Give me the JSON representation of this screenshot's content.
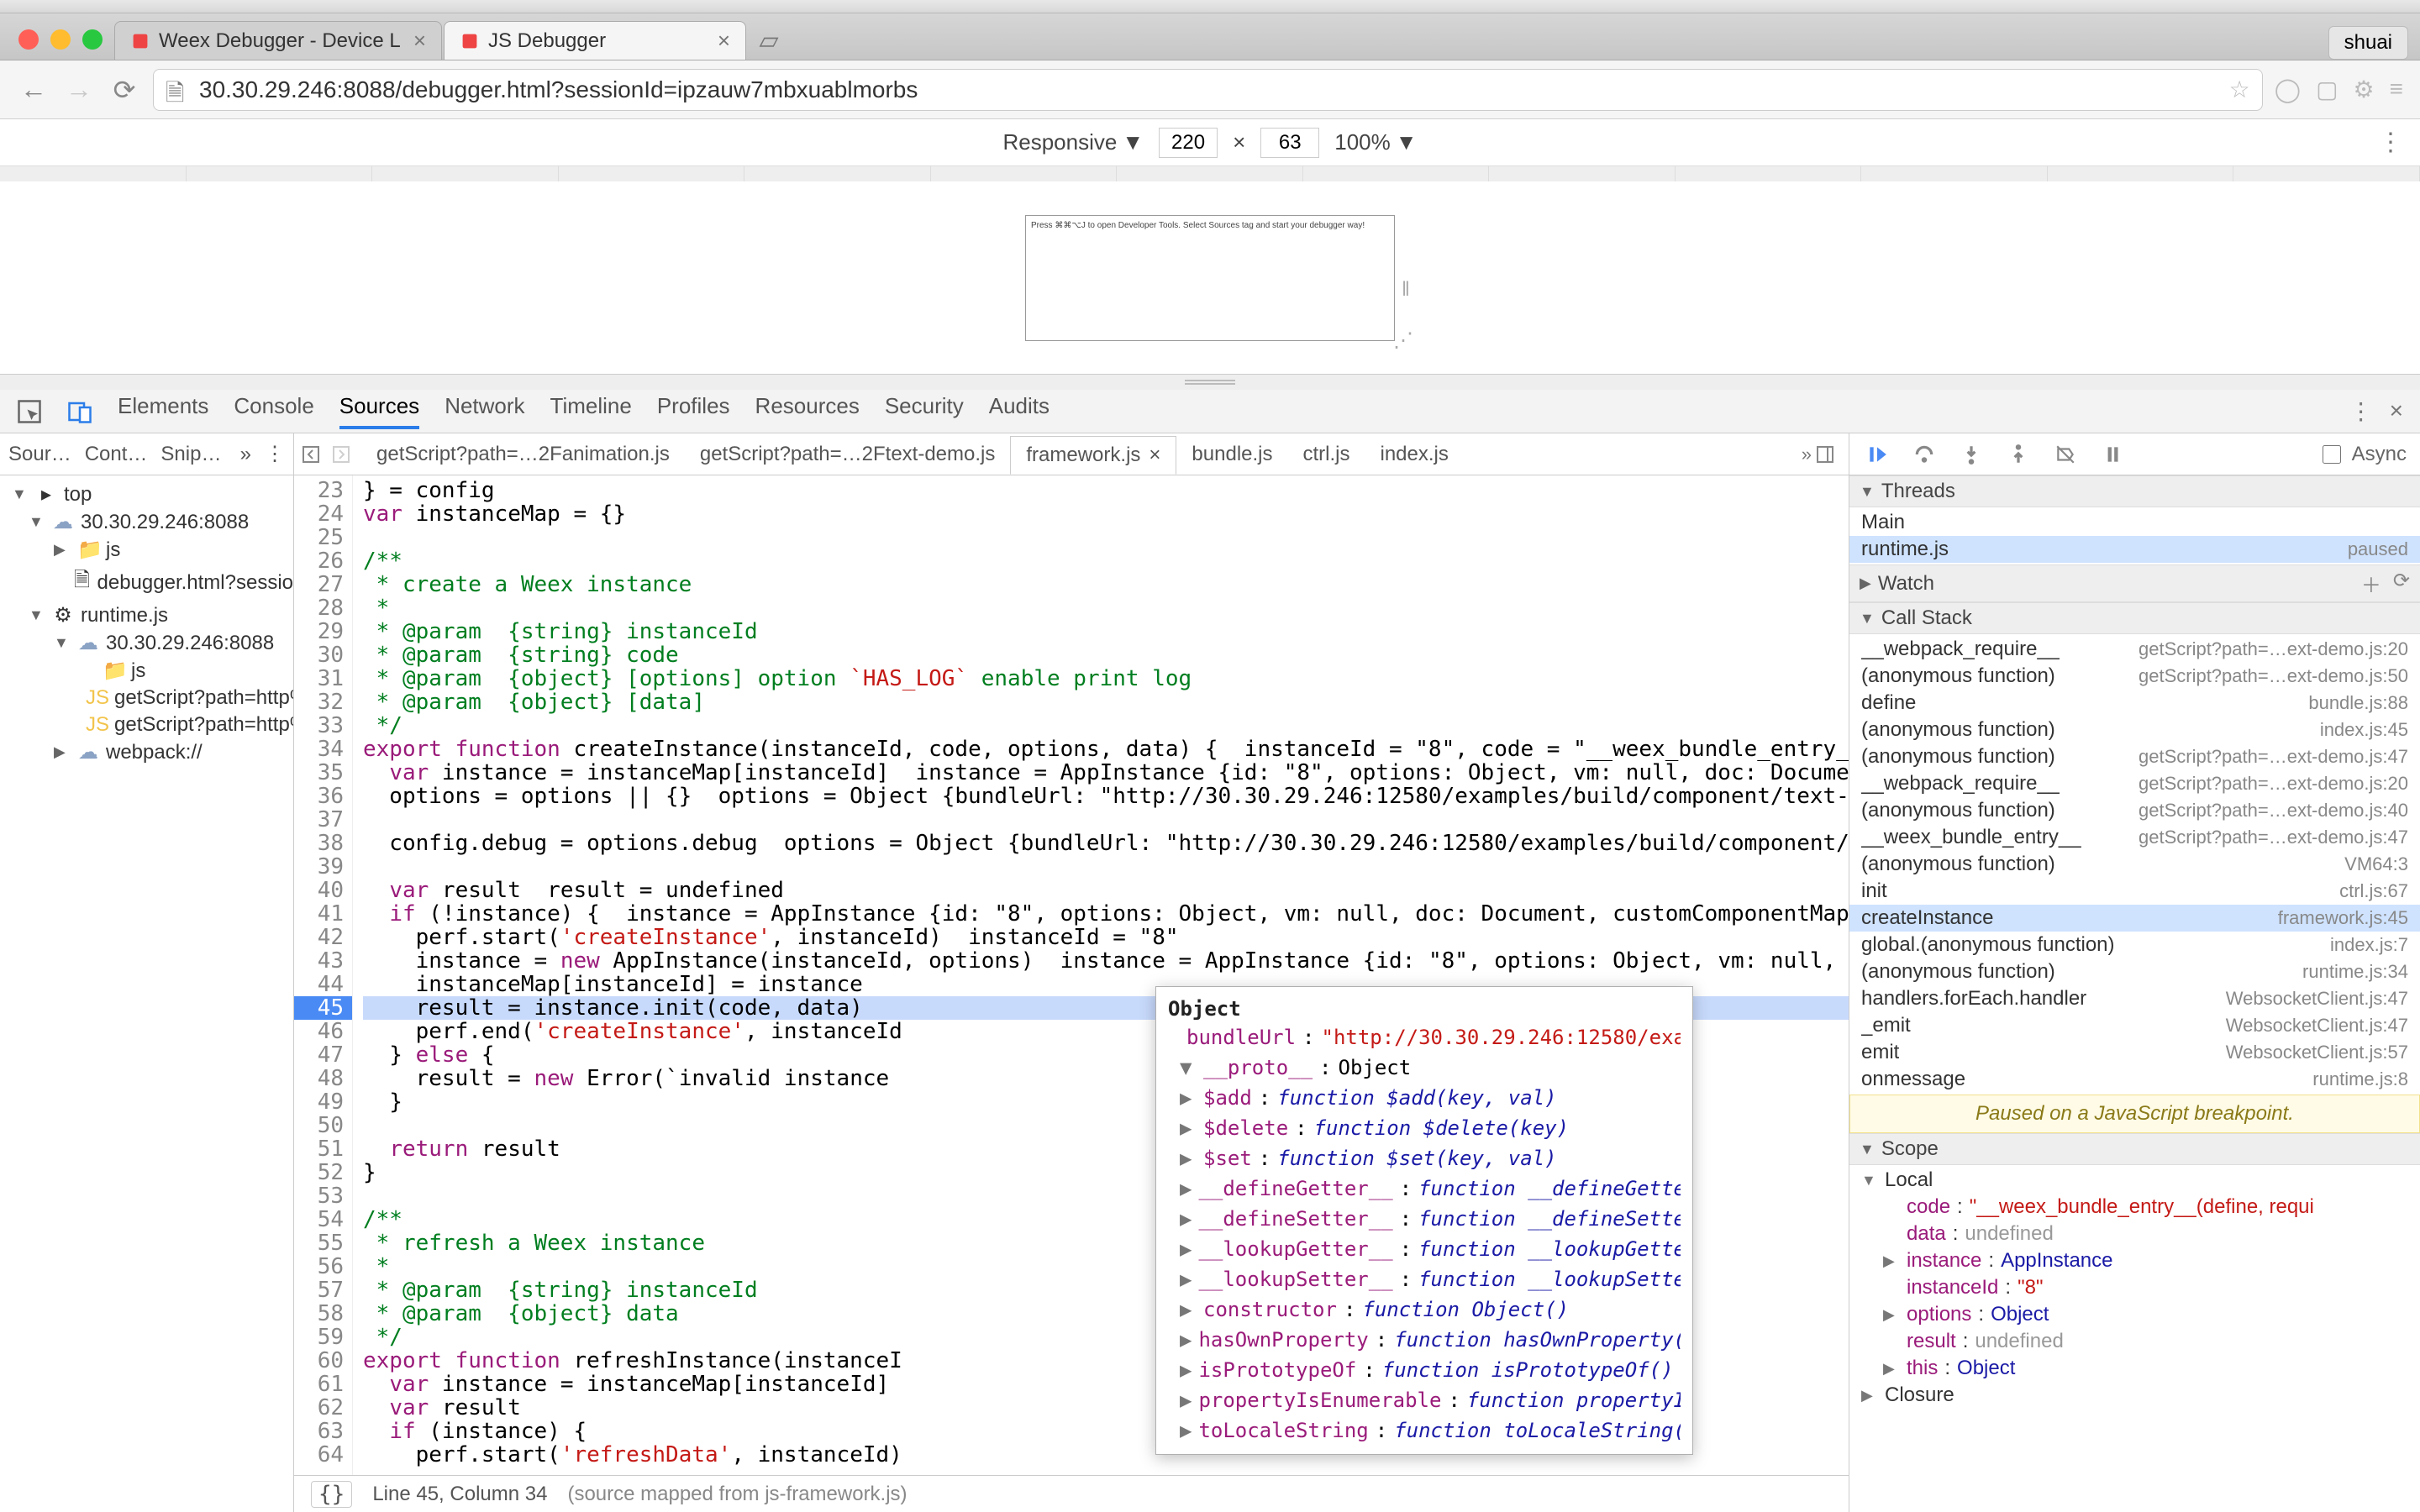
{
  "browser": {
    "tabs": [
      {
        "title": "Weex Debugger - Device L"
      },
      {
        "title": "JS Debugger"
      }
    ],
    "user": "shuai",
    "url": "30.30.29.246:8088/debugger.html?sessionId=ipzauw7mbxuablmorbs"
  },
  "device_toolbar": {
    "mode": "Responsive",
    "width": "220",
    "height": "63",
    "zoom": "100%"
  },
  "device_page_hint": "Press ⌘⌘⌥J to open Developer Tools. Select Sources tag and start your debugger way!",
  "panels": [
    "Elements",
    "Console",
    "Sources",
    "Network",
    "Timeline",
    "Profiles",
    "Resources",
    "Security",
    "Audits"
  ],
  "active_panel": "Sources",
  "file_tabs": {
    "items": [
      "Sour…",
      "Cont…",
      "Snip…"
    ]
  },
  "file_tree": [
    {
      "d": 0,
      "arr": "▼",
      "icon": "top",
      "label": "top"
    },
    {
      "d": 1,
      "arr": "▼",
      "icon": "cloud",
      "label": "30.30.29.246:8088"
    },
    {
      "d": 2,
      "arr": "▶",
      "icon": "folder",
      "label": "js"
    },
    {
      "d": 2,
      "arr": "",
      "icon": "file",
      "label": "debugger.html?sessio"
    },
    {
      "d": 1,
      "arr": "▼",
      "icon": "ext",
      "label": "runtime.js"
    },
    {
      "d": 2,
      "arr": "▼",
      "icon": "cloud",
      "label": "30.30.29.246:8088"
    },
    {
      "d": 3,
      "arr": "",
      "icon": "folder",
      "label": "js"
    },
    {
      "d": 3,
      "arr": "",
      "icon": "js",
      "label": "getScript?path=http%"
    },
    {
      "d": 3,
      "arr": "",
      "icon": "js",
      "label": "getScript?path=http%"
    },
    {
      "d": 2,
      "arr": "▶",
      "icon": "cloud",
      "label": "webpack://"
    }
  ],
  "editor_tabs": [
    {
      "label": "getScript?path=…2Fanimation.js",
      "active": false,
      "close": false
    },
    {
      "label": "getScript?path=…2Ftext-demo.js",
      "active": false,
      "close": false
    },
    {
      "label": "framework.js",
      "active": true,
      "close": true
    },
    {
      "label": "bundle.js",
      "active": false,
      "close": false
    },
    {
      "label": "ctrl.js",
      "active": false,
      "close": false
    },
    {
      "label": "index.js",
      "active": false,
      "close": false
    }
  ],
  "code": {
    "first_line": 23,
    "highlight_line": 45,
    "lines": [
      "} = config",
      "var instanceMap = {}",
      "",
      "/**",
      " * create a Weex instance",
      " *",
      " * @param  {string} instanceId",
      " * @param  {string} code",
      " * @param  {object} [options] option `HAS_LOG` enable print log",
      " * @param  {object} [data]",
      " */",
      "export function createInstance(instanceId, code, options, data) {  instanceId = \"8\", code = \"__weex_bundle_entry__(defin",
      "  var instance = instanceMap[instanceId]  instance = AppInstance {id: \"8\", options: Object, vm: null, doc: Document, cus",
      "  options = options || {}  options = Object {bundleUrl: \"http://30.30.29.246:12580/examples/build/component/text-demo.js",
      "",
      "  config.debug = options.debug  options = Object {bundleUrl: \"http://30.30.29.246:12580/examples/build/component/text-de",
      "",
      "  var result  result = undefined",
      "  if (!instance) {  instance = AppInstance {id: \"8\", options: Object, vm: null, doc: Document, customComponentMap: Objec",
      "    perf.start('createInstance', instanceId)  instanceId = \"8\"",
      "    instance = new AppInstance(instanceId, options)  instance = AppInstance {id: \"8\", options: Object, vm: null, doc: Do",
      "    instanceMap[instanceId] = instance",
      "    result = instance.init(code, data)",
      "    perf.end('createInstance', instanceId",
      "  } else {",
      "    result = new Error(`invalid instance ",
      "  }",
      "",
      "  return result",
      "}",
      "",
      "/**",
      " * refresh a Weex instance",
      " *",
      " * @param  {string} instanceId",
      " * @param  {object} data",
      " */",
      "export function refreshInstance(instanceI",
      "  var instance = instanceMap[instanceId]",
      "  var result",
      "  if (instance) {",
      "    perf.start('refreshData', instanceId)"
    ]
  },
  "tooltip": {
    "header": "Object",
    "bundleUrl_label": "bundleUrl",
    "bundleUrl_value": "\"http://30.30.29.246:12580/exa",
    "proto_label": "__proto__",
    "proto_value": "Object",
    "props": [
      {
        "name": "$add",
        "sig": "function $add(key, val)"
      },
      {
        "name": "$delete",
        "sig": "function $delete(key)"
      },
      {
        "name": "$set",
        "sig": "function $set(key, val)"
      },
      {
        "name": "__defineGetter__",
        "sig": "function __defineGette"
      },
      {
        "name": "__defineSetter__",
        "sig": "function __defineSette"
      },
      {
        "name": "__lookupGetter__",
        "sig": "function __lookupGette"
      },
      {
        "name": "__lookupSetter__",
        "sig": "function __lookupSette"
      },
      {
        "name": "constructor",
        "sig": "function Object()"
      },
      {
        "name": "hasOwnProperty",
        "sig": "function hasOwnProperty("
      },
      {
        "name": "isPrototypeOf",
        "sig": "function isPrototypeOf()"
      },
      {
        "name": "propertyIsEnumerable",
        "sig": "function propertyI"
      },
      {
        "name": "toLocaleString",
        "sig": "function toLocaleString("
      }
    ]
  },
  "statusbar": {
    "pos": "Line 45, Column 34",
    "mapped": "(source mapped from js-framework.js)"
  },
  "debugger": {
    "async_label": "Async",
    "threads_label": "Threads",
    "threads": [
      {
        "name": "Main",
        "loc": ""
      },
      {
        "name": "runtime.js",
        "loc": "paused",
        "sel": true
      }
    ],
    "watch_label": "Watch",
    "callstack_label": "Call Stack",
    "callstack": [
      {
        "name": "__webpack_require__",
        "loc": "getScript?path=…ext-demo.js:20"
      },
      {
        "name": "(anonymous function)",
        "loc": "getScript?path=…ext-demo.js:50"
      },
      {
        "name": "define",
        "loc": "bundle.js:88"
      },
      {
        "name": "(anonymous function)",
        "loc": "index.js:45"
      },
      {
        "name": "(anonymous function)",
        "loc": "getScript?path=…ext-demo.js:47"
      },
      {
        "name": "__webpack_require__",
        "loc": "getScript?path=…ext-demo.js:20"
      },
      {
        "name": "(anonymous function)",
        "loc": "getScript?path=…ext-demo.js:40"
      },
      {
        "name": "__weex_bundle_entry__",
        "loc": "getScript?path=…ext-demo.js:47"
      },
      {
        "name": "(anonymous function)",
        "loc": "VM64:3"
      },
      {
        "name": "init",
        "loc": "ctrl.js:67"
      },
      {
        "name": "createInstance",
        "loc": "framework.js:45",
        "sel": true
      },
      {
        "name": "global.(anonymous function)",
        "loc": "index.js:7"
      },
      {
        "name": "(anonymous function)",
        "loc": "runtime.js:34"
      },
      {
        "name": "handlers.forEach.handler",
        "loc": "WebsocketClient.js:47"
      },
      {
        "name": "_emit",
        "loc": "WebsocketClient.js:47"
      },
      {
        "name": "emit",
        "loc": "WebsocketClient.js:57"
      },
      {
        "name": "onmessage",
        "loc": "runtime.js:8"
      }
    ],
    "pause_banner": "Paused on a JavaScript breakpoint.",
    "scope_label": "Scope",
    "scope": {
      "local_label": "Local",
      "items": [
        {
          "k": "code",
          "v": "\"__weex_bundle_entry__(define, requi",
          "cls": "str"
        },
        {
          "k": "data",
          "v": "undefined",
          "cls": "und"
        },
        {
          "k": "instance",
          "v": "AppInstance",
          "cls": "v",
          "exp": true
        },
        {
          "k": "instanceId",
          "v": "\"8\"",
          "cls": "str"
        },
        {
          "k": "options",
          "v": "Object",
          "cls": "v",
          "exp": true
        },
        {
          "k": "result",
          "v": "undefined",
          "cls": "und"
        },
        {
          "k": "this",
          "v": "Object",
          "cls": "v",
          "exp": true
        }
      ],
      "closure_label": "Closure"
    }
  }
}
